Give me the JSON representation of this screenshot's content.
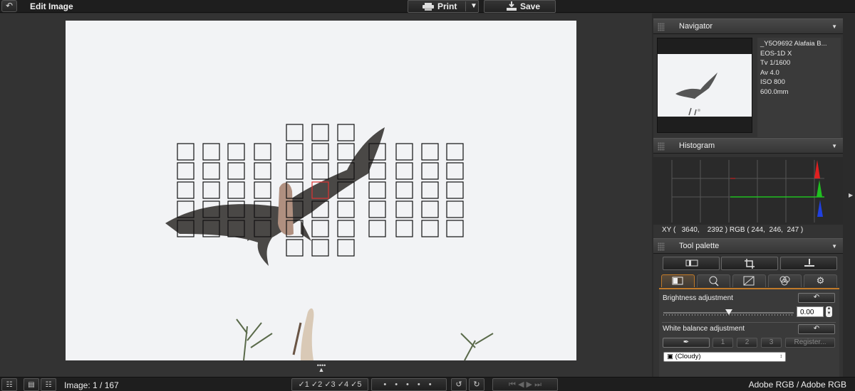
{
  "header": {
    "title": "Edit Image",
    "print_label": "Print",
    "save_label": "Save"
  },
  "navigator": {
    "title": "Navigator",
    "info": [
      "_Y5O9692 Alafaia B...",
      "EOS-1D X",
      "Tv 1/1600",
      "Av 4.0",
      "ISO 800",
      "600.0mm"
    ]
  },
  "histogram": {
    "title": "Histogram",
    "xy_readout": "XY (   3640,    2392 ) RGB ( 244,  246,  247 )",
    "colors": {
      "red": "#e02020",
      "green": "#20c020",
      "blue": "#2040e0"
    }
  },
  "tool_palette": {
    "title": "Tool palette",
    "brightness_label": "Brightness adjustment",
    "brightness_value": "0.00",
    "wb_label": "White balance adjustment",
    "wb_presets": [
      "1",
      "2",
      "3"
    ],
    "register_label": "Register...",
    "wb_selected": "(Cloudy)"
  },
  "footer": {
    "image_count": "Image: 1 / 167",
    "rating_labels": [
      "1",
      "2",
      "3",
      "4",
      "5"
    ],
    "color_space": "Adobe RGB / Adobe RGB"
  },
  "icons": {
    "back": "undo-arrow-icon",
    "print": "printer-icon",
    "save": "save-tray-icon"
  },
  "accent_color": "#c07a2a"
}
